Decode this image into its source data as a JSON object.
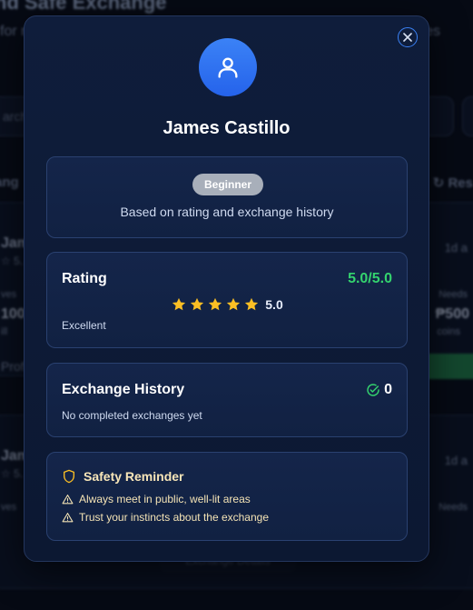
{
  "background": {
    "title": "nd Safe Exchange",
    "subtitle_left": "for r",
    "subtitle_right": "es",
    "search_placeholder": "arch",
    "tab_partial": "ang",
    "reset_label": "Res",
    "cards": [
      {
        "name": "Jam",
        "rating": "☆ 5.",
        "ago": "1d a",
        "gives": "ves",
        "needs": "Needs",
        "amount_left": "100",
        "amount_right": "₱500",
        "unit_left": "ill",
        "unit_right": "coins",
        "profile": "Prof"
      },
      {
        "name": "Jam",
        "rating": "☆ 5.",
        "ago": "1d a",
        "gives": "ves",
        "needs": "Needs"
      }
    ],
    "bottom_button": "Exchange Details"
  },
  "modal": {
    "close_icon": "close-icon",
    "avatar_icon": "user-icon",
    "user_name": "James Castillo",
    "level": {
      "badge": "Beginner",
      "description": "Based on rating and exchange history",
      "badge_color": "#a8afba"
    },
    "rating": {
      "title": "Rating",
      "score": "5.0/5.0",
      "stars": 5,
      "value": "5.0",
      "label": "Excellent",
      "score_color": "#34d36e",
      "star_color": "#fbbf24"
    },
    "history": {
      "title": "Exchange History",
      "count": "0",
      "description": "No completed exchanges yet",
      "icon": "check-circle-icon",
      "icon_color": "#34d36e"
    },
    "safety": {
      "title": "Safety Reminder",
      "icon": "shield-icon",
      "items": [
        "Always meet in public, well-lit areas",
        "Trust your instincts about the exchange"
      ],
      "accent_color": "#fbbf24"
    }
  }
}
